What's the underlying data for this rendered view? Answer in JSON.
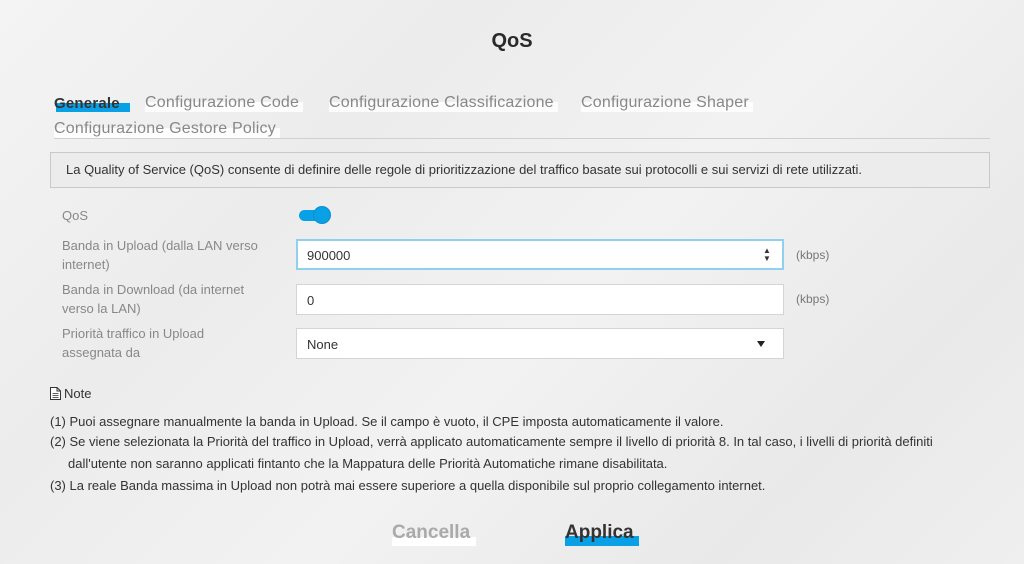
{
  "header": {
    "title": "QoS"
  },
  "tabs": [
    {
      "label": "Generale",
      "active": true
    },
    {
      "label": "Configurazione Code",
      "active": false
    },
    {
      "label": "Configurazione Classificazione",
      "active": false
    },
    {
      "label": "Configurazione Shaper",
      "active": false
    },
    {
      "label": "Configurazione Gestore Policy",
      "active": false
    }
  ],
  "info": "La Quality of Service (QoS) consente di definire delle regole di prioritizzazione del traffico basate sui protocolli e sui servizi di rete utilizzati.",
  "form": {
    "qos": {
      "label": "QoS",
      "enabled": true
    },
    "upload": {
      "label_line1": "Banda in Upload (dalla LAN verso",
      "label_line2": "internet)",
      "value": "900000",
      "unit": "(kbps)"
    },
    "download": {
      "label_line1": "Banda in Download (da internet",
      "label_line2": "verso la LAN)",
      "value": "0",
      "unit": "(kbps)"
    },
    "priority": {
      "label_line1": "Priorità traffico in Upload",
      "label_line2": "assegnata da",
      "selected": "None"
    }
  },
  "notes": {
    "title": "Note",
    "icon": "document-icon",
    "lines": [
      "(1) Puoi assegnare manualmente la banda in Upload. Se il campo è vuoto, il CPE imposta automaticamente il valore.",
      "(2) Se viene selezionata la Priorità del traffico in Upload, verrà applicato automaticamente sempre il livello di priorità 8. In tal caso, i livelli di priorità definiti",
      "dall'utente non saranno applicati fintanto che la Mappatura delle Priorità Automatiche rimane disabilitata.",
      "(3) La reale Banda massima in Upload non potrà mai essere superiore a quella disponibile sul proprio collegamento internet."
    ]
  },
  "buttons": {
    "cancel": "Cancella",
    "apply": "Applica"
  },
  "colors": {
    "accent": "#0aa0e6"
  }
}
